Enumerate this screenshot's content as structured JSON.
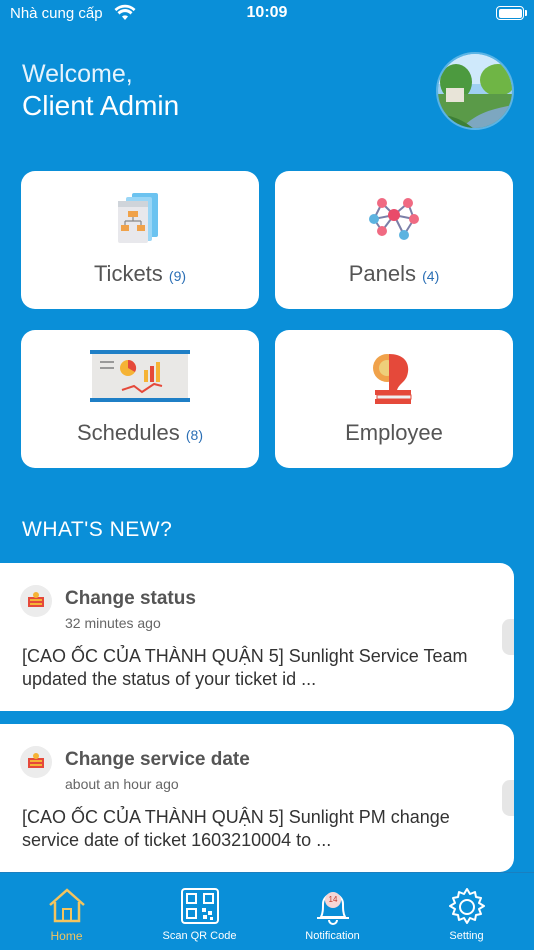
{
  "status_bar": {
    "carrier": "Nhà cung cấp",
    "time": "10:09"
  },
  "header": {
    "welcome": "Welcome,",
    "user_name": "Client Admin"
  },
  "tiles": [
    {
      "label": "Tickets",
      "count": "(9)",
      "icon": "tickets-icon"
    },
    {
      "label": "Panels",
      "count": "(4)",
      "icon": "panels-network-icon"
    },
    {
      "label": "Schedules",
      "count": "(8)",
      "icon": "schedules-board-icon"
    },
    {
      "label": "Employee",
      "count": "",
      "icon": "employee-icon"
    }
  ],
  "whats_new": {
    "heading": "WHAT'S NEW?",
    "items": [
      {
        "title": "Change status",
        "time": "32 minutes ago",
        "body": "[CAO ỐC CỦA THÀNH QUẬN 5] Sunlight Service Team updated the status of your ticket id ..."
      },
      {
        "title": "Change service date",
        "time": "about an hour ago",
        "body": "[CAO ỐC CỦA THÀNH QUẬN 5] Sunlight PM change service date of ticket 1603210004 to ..."
      }
    ]
  },
  "tabbar": {
    "tabs": [
      {
        "label": "Home",
        "icon": "home-icon",
        "active": true
      },
      {
        "label": "Scan QR Code",
        "icon": "qr-code-icon"
      },
      {
        "label": "Notification",
        "icon": "bell-icon",
        "badge": "14"
      },
      {
        "label": "Setting",
        "icon": "gear-icon"
      }
    ]
  },
  "colors": {
    "background": "#0a8fd8",
    "active_tab": "#f3c45e",
    "count": "#2b6fb5"
  }
}
